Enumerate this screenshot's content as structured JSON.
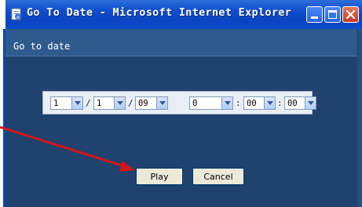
{
  "window": {
    "title": "Go To Date - Microsoft Internet Explorer",
    "icons": {
      "app": "ie-page-icon",
      "minimize": "minimize-icon",
      "maximize": "maximize-icon",
      "close": "close-icon"
    }
  },
  "dialog": {
    "heading": "Go to date",
    "date": {
      "month": "1",
      "day": "1",
      "year": "09",
      "hour": "0",
      "minute": "00",
      "second": "00",
      "date_separator": "/",
      "time_separator": ":"
    },
    "buttons": {
      "play": "Play",
      "cancel": "Cancel"
    }
  },
  "annotation": {
    "arrow_color": "#d0161a"
  },
  "colors": {
    "titlebar": "#0a43be",
    "window_bg": "#1f426f",
    "close_button": "#c4391f"
  }
}
